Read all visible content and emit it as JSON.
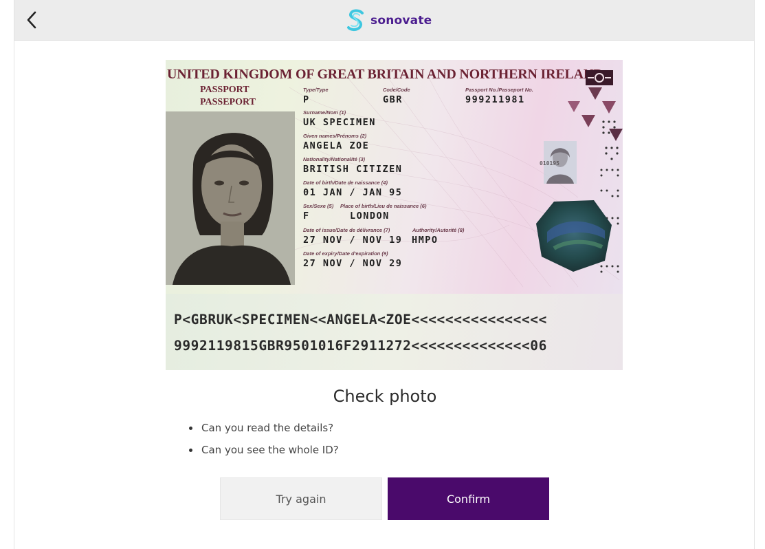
{
  "header": {
    "back_icon": "chevron-left-icon",
    "brand_name": "sonovate",
    "brand_color": "#4b1d8f",
    "logo_icon": "sonovate-s-logo-icon"
  },
  "passport": {
    "country_title": "UNITED KINGDOM OF GREAT BRITAIN AND NORTHERN IRELAND",
    "doc_name_en": "PASSPORT",
    "doc_name_fr": "PASSEPORT",
    "fields": {
      "type_label": "Type/Type",
      "type_value": "P",
      "code_label": "Code/Code",
      "code_value": "GBR",
      "number_label": "Passport No./Passeport No.",
      "number_value": "999211981",
      "surname_label": "Surname/Nom (1)",
      "surname_value": "UK SPECIMEN",
      "given_label": "Given names/Prénoms (2)",
      "given_value": "ANGELA ZOE",
      "nationality_label": "Nationality/Nationalité (3)",
      "nationality_value": "BRITISH CITIZEN",
      "dob_label": "Date of birth/Date de naissance (4)",
      "dob_value": "01 JAN / JAN 95",
      "sex_label": "Sex/Sexe (5)",
      "pob_label": "Place of birth/Lieu de naissance (6)",
      "sex_value": "F",
      "pob_value": "LONDON",
      "issue_label": "Date of issue/Date de délivrance (7)",
      "authority_label": "Authority/Autorité (8)",
      "issue_value": "27 NOV / NOV 19",
      "authority_value": "HMPO",
      "expiry_label": "Date of expiry/Date d'expiration (9)",
      "expiry_value": "27 NOV / NOV 29"
    },
    "mini_photo_text": "010195",
    "mrz_line1": "P<GBRUK<SPECIMEN<<ANGELA<ZOE<<<<<<<<<<<<<<<<",
    "mrz_line2": "9992119815GBR9501016F2911272<<<<<<<<<<<<<<06"
  },
  "check": {
    "title": "Check photo",
    "items": [
      "Can you read the details?",
      "Can you see the whole ID?"
    ]
  },
  "actions": {
    "try_again_label": "Try again",
    "confirm_label": "Confirm",
    "confirm_color": "#4a0a6b"
  }
}
